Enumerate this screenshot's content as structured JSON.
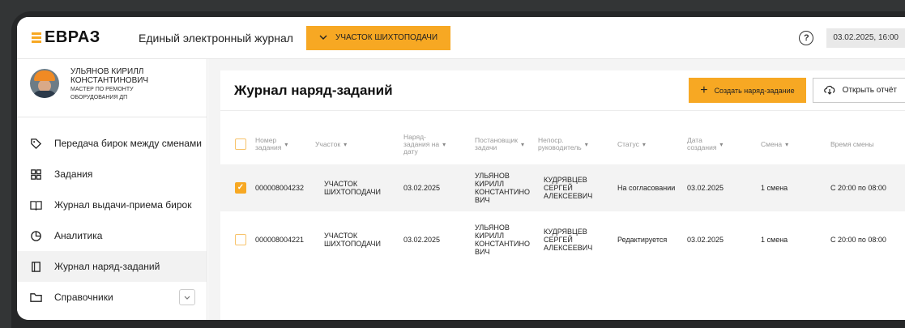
{
  "header": {
    "logo_text": "ЕВРАЗ",
    "app_title": "Единый электронный журнал",
    "area_button_label": "УЧАСТОК ШИХТОПОДАЧИ",
    "datetime": "03.02.2025, 16:00"
  },
  "user": {
    "name_line1": "УЛЬЯНОВ КИРИЛЛ",
    "name_line2": "КОНСТАНТИНОВИЧ",
    "role_line1": "МАСТЕР ПО РЕМОНТУ",
    "role_line2": "ОБОРУДОВАНИЯ ДП"
  },
  "sidebar": {
    "items": [
      {
        "label": "Передача бирок между сменами",
        "icon": "tag-icon"
      },
      {
        "label": "Задания",
        "icon": "grid-icon"
      },
      {
        "label": "Журнал выдачи-приема бирок",
        "icon": "book-icon"
      },
      {
        "label": "Аналитика",
        "icon": "pie-chart-icon"
      },
      {
        "label": "Журнал наряд-заданий",
        "icon": "clipboard-icon",
        "active": true
      },
      {
        "label": "Справочники",
        "icon": "folder-icon"
      }
    ]
  },
  "page": {
    "title": "Журнал наряд-заданий",
    "create_button": "Создать наряд-задание",
    "report_button": "Открыть отчёт"
  },
  "table": {
    "columns": [
      {
        "l1": "Номер",
        "l2": "задания",
        "l3": ""
      },
      {
        "l1": "Участок",
        "l2": "",
        "l3": ""
      },
      {
        "l1": "Наряд-",
        "l2": "задания на",
        "l3": "дату"
      },
      {
        "l1": "Постановщик",
        "l2": "задачи",
        "l3": ""
      },
      {
        "l1": "Непоср.",
        "l2": "руководитель",
        "l3": ""
      },
      {
        "l1": "Статус",
        "l2": "",
        "l3": ""
      },
      {
        "l1": "Дата",
        "l2": "создания",
        "l3": ""
      },
      {
        "l1": "Смена",
        "l2": "",
        "l3": ""
      },
      {
        "l1": "Время смены",
        "l2": "",
        "l3": ""
      }
    ],
    "rows": [
      {
        "checked": true,
        "number": "000008004232",
        "area_l1": "УЧАСТОК",
        "area_l2": "ШИХТОПОДАЧИ",
        "date": "03.02.2025",
        "creator_l1": "УЛЬЯНОВ",
        "creator_l2": "КИРИЛЛ",
        "creator_l3": "КОНСТАНТИНО",
        "creator_l4": "ВИЧ",
        "manager_l1": "КУДРЯВЦЕВ",
        "manager_l2": "СЕРГЕЙ",
        "manager_l3": "АЛЕКСЕЕВИЧ",
        "status": "На согласовании",
        "created": "03.02.2025",
        "shift": "1 смена",
        "shift_time": "С 20:00 по 08:00"
      },
      {
        "checked": false,
        "number": "000008004221",
        "area_l1": "УЧАСТОК",
        "area_l2": "ШИХТОПОДАЧИ",
        "date": "03.02.2025",
        "creator_l1": "УЛЬЯНОВ",
        "creator_l2": "КИРИЛЛ",
        "creator_l3": "КОНСТАНТИНО",
        "creator_l4": "ВИЧ",
        "manager_l1": "КУДРЯВЦЕВ",
        "manager_l2": "СЕРГЕЙ",
        "manager_l3": "АЛЕКСЕЕВИЧ",
        "status": "Редактируется",
        "created": "03.02.2025",
        "shift": "1 смена",
        "shift_time": "С 20:00 по 08:00"
      }
    ]
  },
  "colors": {
    "accent": "#f7a823",
    "bezel": "#262728",
    "background": "#333536"
  }
}
